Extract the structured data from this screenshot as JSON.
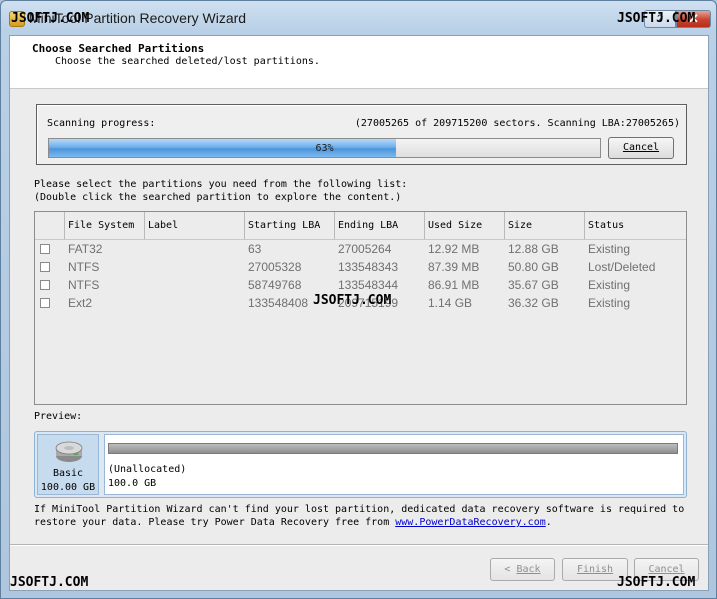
{
  "window": {
    "title": "MiniTool Partition Recovery Wizard",
    "help_label": "?",
    "close_label": "✕"
  },
  "header": {
    "title": "Choose Searched Partitions",
    "subtitle": "Choose the searched deleted/lost partitions."
  },
  "scan": {
    "label": "Scanning progress:",
    "stats": "(27005265 of 209715200 sectors. Scanning LBA:27005265)",
    "progress_percent": 63,
    "progress_text": "63%",
    "cancel_label": "Cancel"
  },
  "instructions": {
    "line1": "Please select the partitions you need from the following list:",
    "line2": "(Double click the searched partition to explore the content.)"
  },
  "partitions": {
    "columns": [
      "File System",
      "Label",
      "Starting LBA",
      "Ending LBA",
      "Used Size",
      "Size",
      "Status"
    ],
    "rows": [
      {
        "checked": false,
        "file_system": "FAT32",
        "label": "",
        "starting_lba": "63",
        "ending_lba": "27005264",
        "used_size": "12.92 MB",
        "size": "12.88 GB",
        "status": "Existing"
      },
      {
        "checked": false,
        "file_system": "NTFS",
        "label": "",
        "starting_lba": "27005328",
        "ending_lba": "133548343",
        "used_size": "87.39 MB",
        "size": "50.80 GB",
        "status": "Lost/Deleted"
      },
      {
        "checked": false,
        "file_system": "NTFS",
        "label": "",
        "starting_lba": "58749768",
        "ending_lba": "133548344",
        "used_size": "86.91 MB",
        "size": "35.67 GB",
        "status": "Existing"
      },
      {
        "checked": false,
        "file_system": "Ext2",
        "label": "",
        "starting_lba": "133548408",
        "ending_lba": "209715199",
        "used_size": "1.14 GB",
        "size": "36.32 GB",
        "status": "Existing"
      }
    ]
  },
  "preview": {
    "label": "Preview:",
    "disk_type": "Basic",
    "disk_size": "100.00 GB",
    "disk_icon": "hard-disk-icon",
    "segment_label": "(Unallocated)",
    "segment_size": "100.0 GB"
  },
  "info": {
    "line1": "If MiniTool Partition Wizard can't find your lost partition, dedicated data recovery software is required to",
    "line2_prefix": "restore your data. Please try Power Data Recovery free from ",
    "link_text": "www.PowerDataRecovery.com",
    "line2_suffix": "."
  },
  "buttons": {
    "back_label": "Back",
    "finish_label": "Finish",
    "cancel_label": "Cancel"
  },
  "watermark": "JSOFTJ.COM"
}
